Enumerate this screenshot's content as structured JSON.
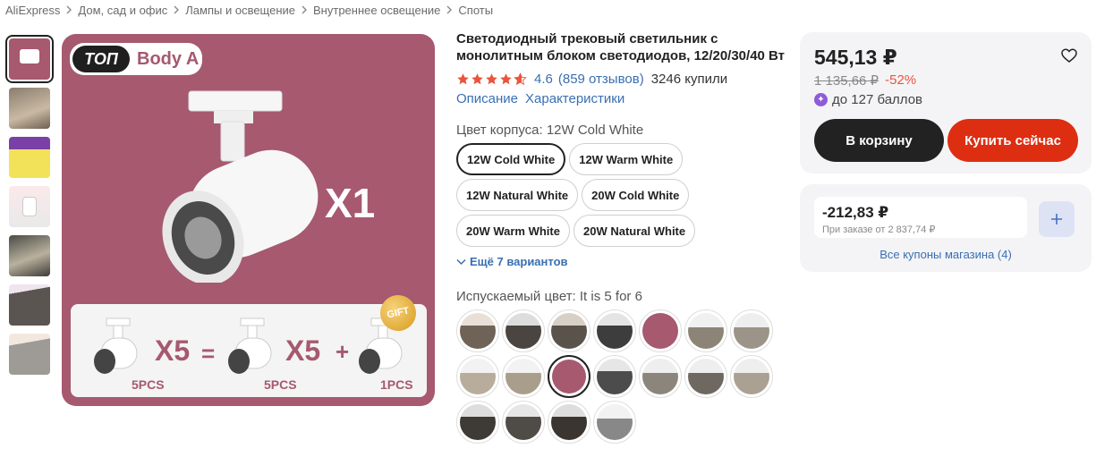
{
  "breadcrumb": [
    "AliExpress",
    "Дом, сад и офис",
    "Лампы и освещение",
    "Внутреннее освещение",
    "Споты"
  ],
  "gallery": {
    "badge_top": "ТОП",
    "badge_body": "Body A",
    "main_text": "X1",
    "bundle": {
      "mult_left": "X5",
      "equals": "=",
      "mult_right": "X5",
      "plus": "+",
      "gift": "GIFT",
      "label_1": "5PCS",
      "label_2": "5PCS",
      "label_3": "1PCS"
    }
  },
  "product": {
    "title": "Светодиодный трековый светильник с монолитным блоком светодиодов, 12/20/30/40 Вт",
    "rating": "4.6",
    "reviews": "(859 отзывов)",
    "sold": "3246 купили",
    "link_description": "Описание",
    "link_specs": "Характеристики",
    "color_label": "Цвет корпуса: 12W Cold White",
    "variants": [
      "12W Cold White",
      "12W Warm White",
      "12W Natural White",
      "20W Cold White",
      "20W Warm White",
      "20W Natural White"
    ],
    "more_variants": "Ещё 7 вариантов",
    "emit_label": "Испускаемый цвет: It is 5 for 6"
  },
  "buybox": {
    "price": "545,13 ₽",
    "old_price": "1 135,66 ₽",
    "discount": "-52%",
    "points": "до 127 баллов",
    "cart_button": "В корзину",
    "buy_button": "Купить сейчас"
  },
  "coupon": {
    "amount": "-212,83 ₽",
    "condition": "При заказе от 2 837,74 ₽",
    "all_coupons": "Все купоны магазина (4)"
  },
  "colors": {
    "accent_blue": "#3a6fb0",
    "buy_red": "#dd2e12",
    "image_bg": "#a6596f",
    "star": "#e8553d"
  }
}
